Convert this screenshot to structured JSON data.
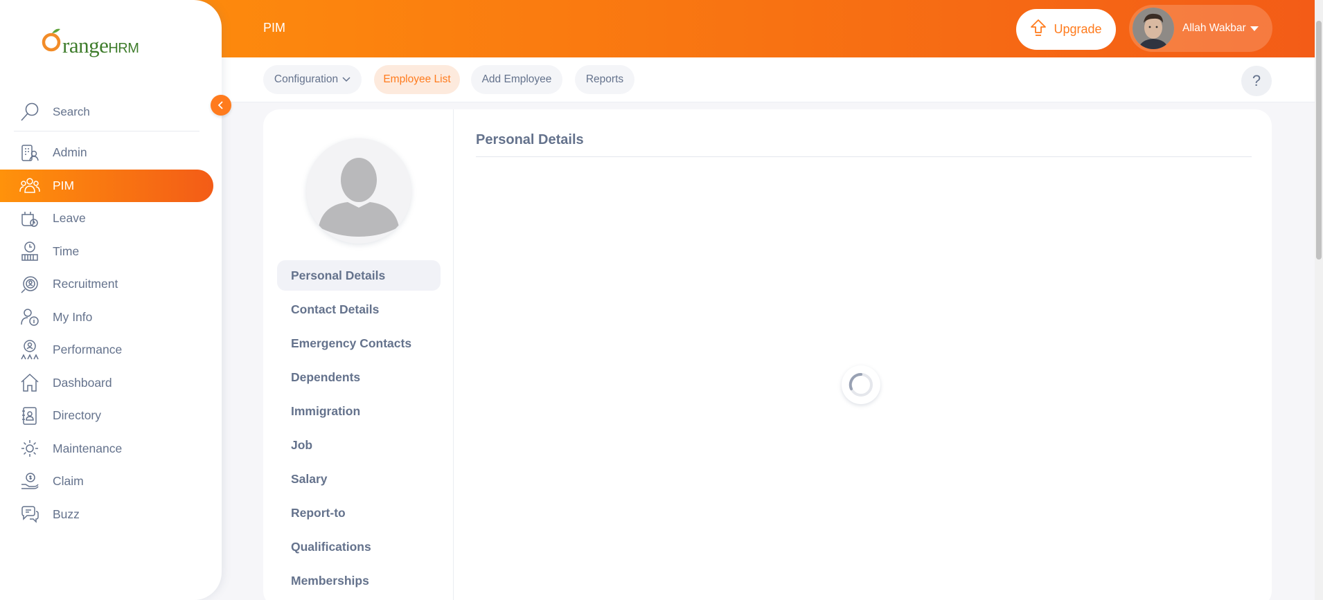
{
  "brand": {
    "logo_text_main": "range",
    "logo_text_o": "O",
    "logo_text_hrm": "HRM"
  },
  "topbar": {
    "title": "PIM",
    "upgrade_label": "Upgrade",
    "user_name": "Allah Wakbar"
  },
  "search": {
    "placeholder": "Search"
  },
  "sidebar": {
    "items": [
      {
        "label": "Admin",
        "icon": "admin-icon"
      },
      {
        "label": "PIM",
        "icon": "pim-icon",
        "active": true
      },
      {
        "label": "Leave",
        "icon": "leave-icon"
      },
      {
        "label": "Time",
        "icon": "time-icon"
      },
      {
        "label": "Recruitment",
        "icon": "recruitment-icon"
      },
      {
        "label": "My Info",
        "icon": "my-info-icon"
      },
      {
        "label": "Performance",
        "icon": "performance-icon"
      },
      {
        "label": "Dashboard",
        "icon": "dashboard-icon"
      },
      {
        "label": "Directory",
        "icon": "directory-icon"
      },
      {
        "label": "Maintenance",
        "icon": "maintenance-icon"
      },
      {
        "label": "Claim",
        "icon": "claim-icon"
      },
      {
        "label": "Buzz",
        "icon": "buzz-icon"
      }
    ]
  },
  "subnav": {
    "configuration": "Configuration",
    "employee_list": "Employee List",
    "add_employee": "Add Employee",
    "reports": "Reports",
    "help": "?"
  },
  "profile_tabs": [
    {
      "label": "Personal Details",
      "active": true
    },
    {
      "label": "Contact Details"
    },
    {
      "label": "Emergency Contacts"
    },
    {
      "label": "Dependents"
    },
    {
      "label": "Immigration"
    },
    {
      "label": "Job"
    },
    {
      "label": "Salary"
    },
    {
      "label": "Report-to"
    },
    {
      "label": "Qualifications"
    },
    {
      "label": "Memberships"
    }
  ],
  "main": {
    "section_title": "Personal Details"
  },
  "colors": {
    "accent": "#ff7b1d",
    "gradient_start": "#ff920b",
    "gradient_end": "#f35c17",
    "text": "#64728c"
  }
}
